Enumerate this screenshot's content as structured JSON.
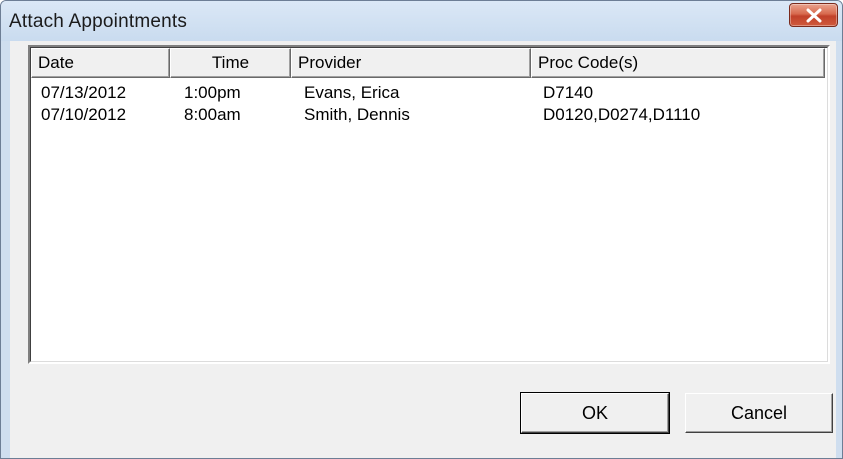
{
  "window": {
    "title": "Attach Appointments"
  },
  "list": {
    "columns": [
      "Date",
      "Time",
      "Provider",
      "Proc Code(s)"
    ],
    "rows": [
      [
        "07/13/2012",
        "1:00pm",
        "Evans, Erica",
        "D7140"
      ],
      [
        "07/10/2012",
        "8:00am",
        "Smith, Dennis",
        "D0120,D0274,D1110"
      ]
    ]
  },
  "buttons": {
    "ok_label": "OK",
    "cancel_label": "Cancel"
  },
  "icons": {
    "close": "close-icon"
  },
  "colors": {
    "close_button": "#c8472f",
    "titlebar": "#cfdeef",
    "client_bg": "#f0f0f0"
  }
}
